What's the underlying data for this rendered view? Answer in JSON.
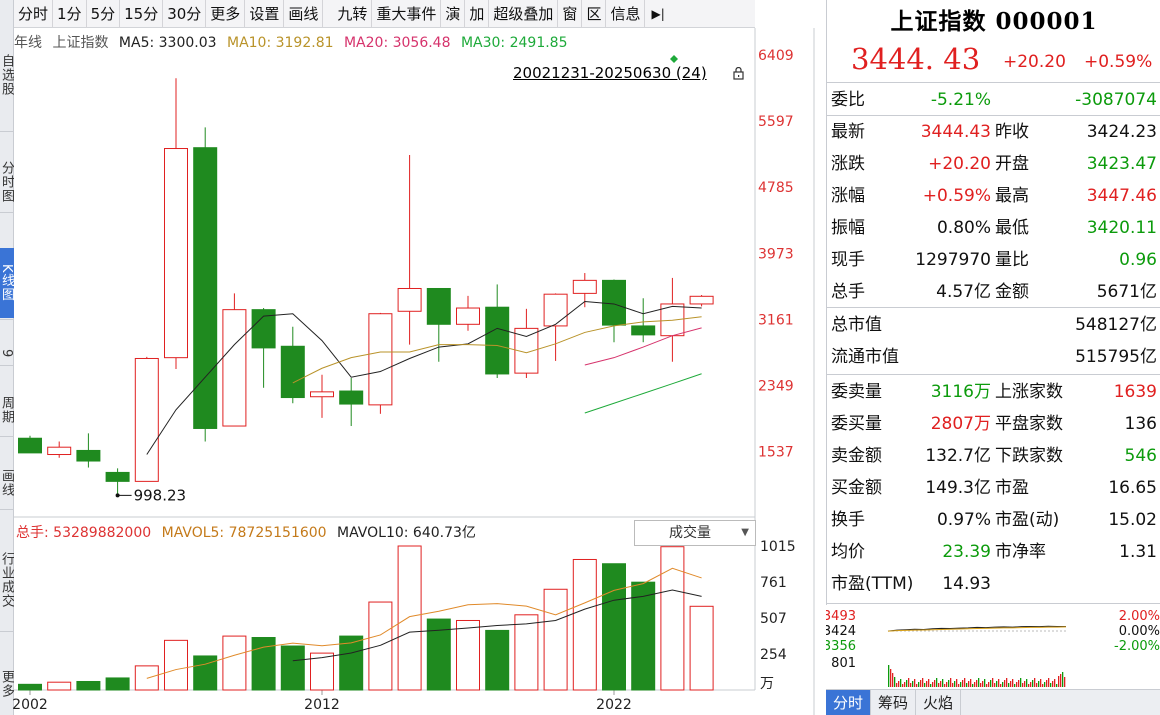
{
  "left_nav": [
    "自选股",
    "分时图",
    "K线图",
    "9",
    "周期",
    "画线",
    "行业成交",
    "更多"
  ],
  "toolbar": {
    "items": [
      "分时",
      "1分",
      "5分",
      "15分",
      "30分",
      "更多",
      "设置",
      "画线",
      "九转",
      "重大事件",
      "演",
      "加",
      "超级叠加",
      "窗",
      "区",
      "信息"
    ],
    "collapse_icon": "collapse-right-icon"
  },
  "ma_line": {
    "period": "年线",
    "name": "上证指数",
    "ma5": "MA5: 3300.03",
    "ma10": "MA10: 3192.81",
    "ma20": "MA20: 3056.48",
    "ma30": "MA30: 2491.85"
  },
  "range_label": "20021231-20250630 (24)",
  "annotations": {
    "high": "6124.04",
    "low": "998.23"
  },
  "volume_line": {
    "total": "总手: 53289882000",
    "mavol5": "MAVOL5: 78725151600",
    "mavol10": "MAVOL10: 640.73亿"
  },
  "volume_select": "成交量",
  "colors": {
    "up": "#e02020",
    "down": "#1f8a1f",
    "ma5": "#222222",
    "ma10": "#b9932a",
    "ma20": "#d6336c",
    "ma30": "#1eaa3a",
    "accent": "#3a74d6"
  },
  "chart_data": {
    "type": "candlestick",
    "title": "上证指数 年线",
    "x_tick_labels": [
      "2002",
      "2012",
      "2022"
    ],
    "price_axis_labels": [
      "6409",
      "5597",
      "4785",
      "3973",
      "3161",
      "2349",
      "1537"
    ],
    "volume_axis_labels": [
      "1015",
      "761",
      "507",
      "254"
    ],
    "volume_unit": "万",
    "ylim": [
      1150,
      6409
    ],
    "vol_max": 1015,
    "candles": [
      {
        "year": 2002,
        "o": 1700,
        "h": 1730,
        "l": 1520,
        "c": 1520
      },
      {
        "year": 2003,
        "o": 1500,
        "h": 1660,
        "l": 1460,
        "c": 1590
      },
      {
        "year": 2004,
        "o": 1550,
        "h": 1760,
        "l": 1340,
        "c": 1420
      },
      {
        "year": 2005,
        "o": 1280,
        "h": 1330,
        "l": 998,
        "c": 1170
      },
      {
        "year": 2006,
        "o": 1170,
        "h": 2700,
        "l": 1170,
        "c": 2680
      },
      {
        "year": 2007,
        "o": 2690,
        "h": 6124,
        "l": 2550,
        "c": 5260
      },
      {
        "year": 2008,
        "o": 5270,
        "h": 5520,
        "l": 1660,
        "c": 1820
      },
      {
        "year": 2009,
        "o": 1850,
        "h": 3480,
        "l": 1850,
        "c": 3280
      },
      {
        "year": 2010,
        "o": 3280,
        "h": 3300,
        "l": 2320,
        "c": 2810
      },
      {
        "year": 2011,
        "o": 2830,
        "h": 3070,
        "l": 2130,
        "c": 2200
      },
      {
        "year": 2012,
        "o": 2210,
        "h": 2480,
        "l": 1950,
        "c": 2270
      },
      {
        "year": 2013,
        "o": 2280,
        "h": 2440,
        "l": 1850,
        "c": 2120
      },
      {
        "year": 2014,
        "o": 2110,
        "h": 3240,
        "l": 2000,
        "c": 3230
      },
      {
        "year": 2015,
        "o": 3260,
        "h": 5180,
        "l": 2850,
        "c": 3540
      },
      {
        "year": 2016,
        "o": 3540,
        "h": 3540,
        "l": 2640,
        "c": 3100
      },
      {
        "year": 2017,
        "o": 3100,
        "h": 3450,
        "l": 3020,
        "c": 3300
      },
      {
        "year": 2018,
        "o": 3310,
        "h": 3590,
        "l": 2440,
        "c": 2490
      },
      {
        "year": 2019,
        "o": 2500,
        "h": 3290,
        "l": 2440,
        "c": 3050
      },
      {
        "year": 2020,
        "o": 3080,
        "h": 3480,
        "l": 2650,
        "c": 3470
      },
      {
        "year": 2021,
        "o": 3480,
        "h": 3730,
        "l": 3310,
        "c": 3640
      },
      {
        "year": 2022,
        "o": 3640,
        "h": 3650,
        "l": 2880,
        "c": 3090
      },
      {
        "year": 2023,
        "o": 3080,
        "h": 3420,
        "l": 2880,
        "c": 2970
      },
      {
        "year": 2024,
        "o": 2960,
        "h": 3670,
        "l": 2640,
        "c": 3350
      },
      {
        "year": 2025,
        "o": 3350,
        "h": 3460,
        "l": 3320,
        "c": 3444
      }
    ],
    "volumes": [
      40,
      55,
      60,
      85,
      170,
      350,
      240,
      380,
      370,
      310,
      260,
      380,
      620,
      1015,
      500,
      490,
      420,
      530,
      710,
      920,
      890,
      760,
      1010,
      590
    ],
    "ma5": [
      null,
      null,
      null,
      null,
      1500,
      2050,
      2450,
      2850,
      3200,
      3230,
      2900,
      2450,
      2520,
      2680,
      2820,
      2860,
      3050,
      2950,
      3100,
      3380,
      3350,
      3230,
      3320,
      3300
    ],
    "ma10": [
      null,
      null,
      null,
      null,
      null,
      null,
      null,
      null,
      null,
      2380,
      2560,
      2690,
      2760,
      2760,
      2850,
      2850,
      2840,
      2750,
      2860,
      3000,
      3080,
      3130,
      3150,
      3193
    ],
    "ma20": [
      null,
      null,
      null,
      null,
      null,
      null,
      null,
      null,
      null,
      null,
      null,
      null,
      null,
      null,
      null,
      null,
      null,
      null,
      null,
      2600,
      2690,
      2820,
      2960,
      3056
    ],
    "ma30": [
      null,
      null,
      null,
      null,
      null,
      null,
      null,
      null,
      null,
      null,
      null,
      null,
      null,
      null,
      null,
      null,
      null,
      null,
      null,
      2010,
      2130,
      2250,
      2370,
      2492
    ],
    "mavol5": [
      null,
      null,
      null,
      null,
      82,
      144,
      182,
      245,
      302,
      330,
      312,
      332,
      388,
      517,
      555,
      601,
      609,
      591,
      530,
      614,
      702,
      750,
      858,
      790
    ],
    "mavol10": [
      null,
      null,
      null,
      null,
      null,
      null,
      null,
      null,
      null,
      206,
      228,
      261,
      315,
      408,
      421,
      437,
      455,
      466,
      490,
      570,
      633,
      660,
      705,
      660
    ]
  },
  "panel": {
    "title": "上证指数 000001",
    "price": "3444. 43",
    "change": "+20.20",
    "change_pct": "+0.59%",
    "weibi": {
      "label": "委比",
      "v1": "-5.21%",
      "v2": "-3087074"
    },
    "quote_rows": [
      [
        {
          "label": "最新",
          "value": "3444.43",
          "c": "r"
        },
        {
          "label": "昨收",
          "value": "3424.23",
          "c": "k"
        }
      ],
      [
        {
          "label": "涨跌",
          "value": "+20.20",
          "c": "r"
        },
        {
          "label": "开盘",
          "value": "3423.47",
          "c": "g"
        }
      ],
      [
        {
          "label": "涨幅",
          "value": "+0.59%",
          "c": "r"
        },
        {
          "label": "最高",
          "value": "3447.46",
          "c": "r"
        }
      ],
      [
        {
          "label": "振幅",
          "value": "0.80%",
          "c": "k"
        },
        {
          "label": "最低",
          "value": "3420.11",
          "c": "g"
        }
      ],
      [
        {
          "label": "现手",
          "value": "1297970",
          "c": "k"
        },
        {
          "label": "量比",
          "value": "0.96",
          "c": "g"
        }
      ],
      [
        {
          "label": "总手",
          "value": "4.57亿",
          "c": "k"
        },
        {
          "label": "金额",
          "value": "5671亿",
          "c": "k"
        }
      ]
    ],
    "cap_rows": [
      {
        "label": "总市值",
        "value": "548127亿"
      },
      {
        "label": "流通市值",
        "value": "515795亿"
      }
    ],
    "stat_rows": [
      [
        {
          "label": "委卖量",
          "value": "3116万",
          "c": "g"
        },
        {
          "label": "上涨家数",
          "value": "1639",
          "c": "r"
        }
      ],
      [
        {
          "label": "委买量",
          "value": "2807万",
          "c": "r"
        },
        {
          "label": "平盘家数",
          "value": "136",
          "c": "k"
        }
      ],
      [
        {
          "label": "卖金额",
          "value": "132.7亿",
          "c": "k"
        },
        {
          "label": "下跌家数",
          "value": "546",
          "c": "g"
        }
      ],
      [
        {
          "label": "买金额",
          "value": "149.3亿",
          "c": "k"
        },
        {
          "label": "市盈",
          "value": "16.65",
          "c": "k"
        }
      ],
      [
        {
          "label": "换手",
          "value": "0.97%",
          "c": "k"
        },
        {
          "label": "市盈(动)",
          "value": "15.02",
          "c": "k"
        }
      ],
      [
        {
          "label": "均价",
          "value": "23.39",
          "c": "g"
        },
        {
          "label": "市净率",
          "value": "1.31",
          "c": "k"
        }
      ],
      [
        {
          "label": "市盈(TTM)",
          "value": "14.93",
          "c": "k"
        }
      ]
    ]
  },
  "mini_chart": {
    "left_labels": [
      "3493",
      "3424",
      "3356",
      "801"
    ],
    "right_labels": [
      "2.00%",
      "0.00%",
      "-2.00%"
    ],
    "price_line": [
      3424,
      3428,
      3430,
      3432,
      3431,
      3434,
      3436,
      3435,
      3437,
      3438,
      3440,
      3439,
      3441,
      3442,
      3441,
      3443,
      3444,
      3443,
      3445,
      3444,
      3444
    ],
    "avg_line": [
      3424,
      3426,
      3427,
      3428,
      3429,
      3430,
      3431,
      3432,
      3433,
      3434,
      3435,
      3436,
      3437,
      3438,
      3438,
      3439,
      3440,
      3440,
      3441,
      3441,
      3442
    ]
  },
  "mini_tabs": [
    "分时",
    "筹码",
    "火焰"
  ]
}
